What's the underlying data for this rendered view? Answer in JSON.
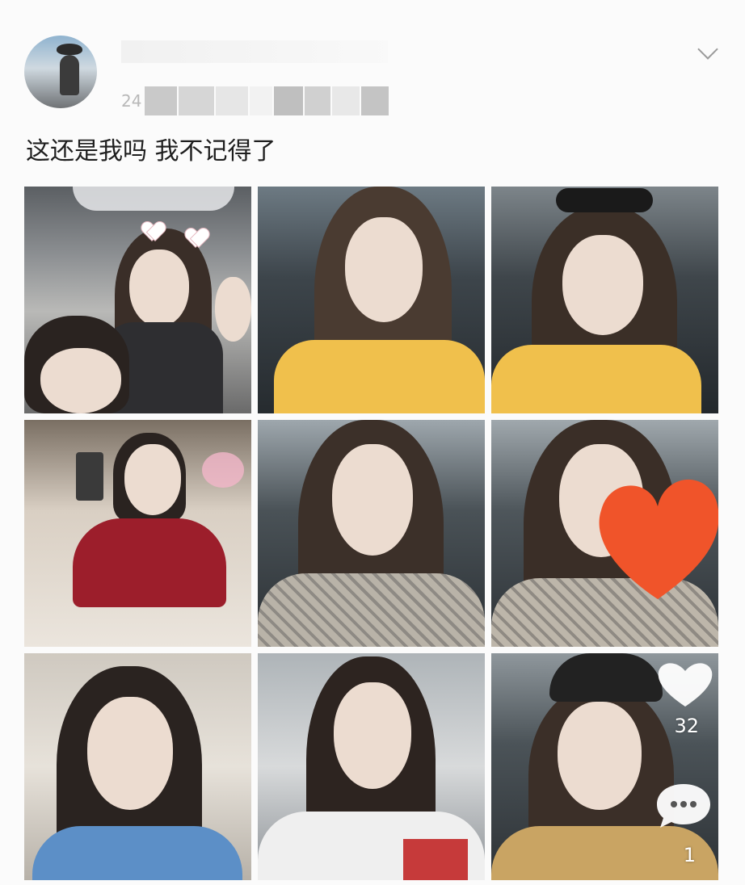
{
  "post": {
    "meta_prefix": "24",
    "text": "这还是我吗 我不记得了"
  },
  "icons": {
    "collapse": "chevron-down-icon",
    "like": "heart-icon",
    "comment": "comment-bubble-icon"
  },
  "reactions": {
    "likes": "32",
    "comments": "1"
  },
  "colors": {
    "background": "#fbfbfb",
    "text": "#1e1e1e",
    "sticker_heart": "#f0542a",
    "pink_heart": "#f3b7c9"
  }
}
